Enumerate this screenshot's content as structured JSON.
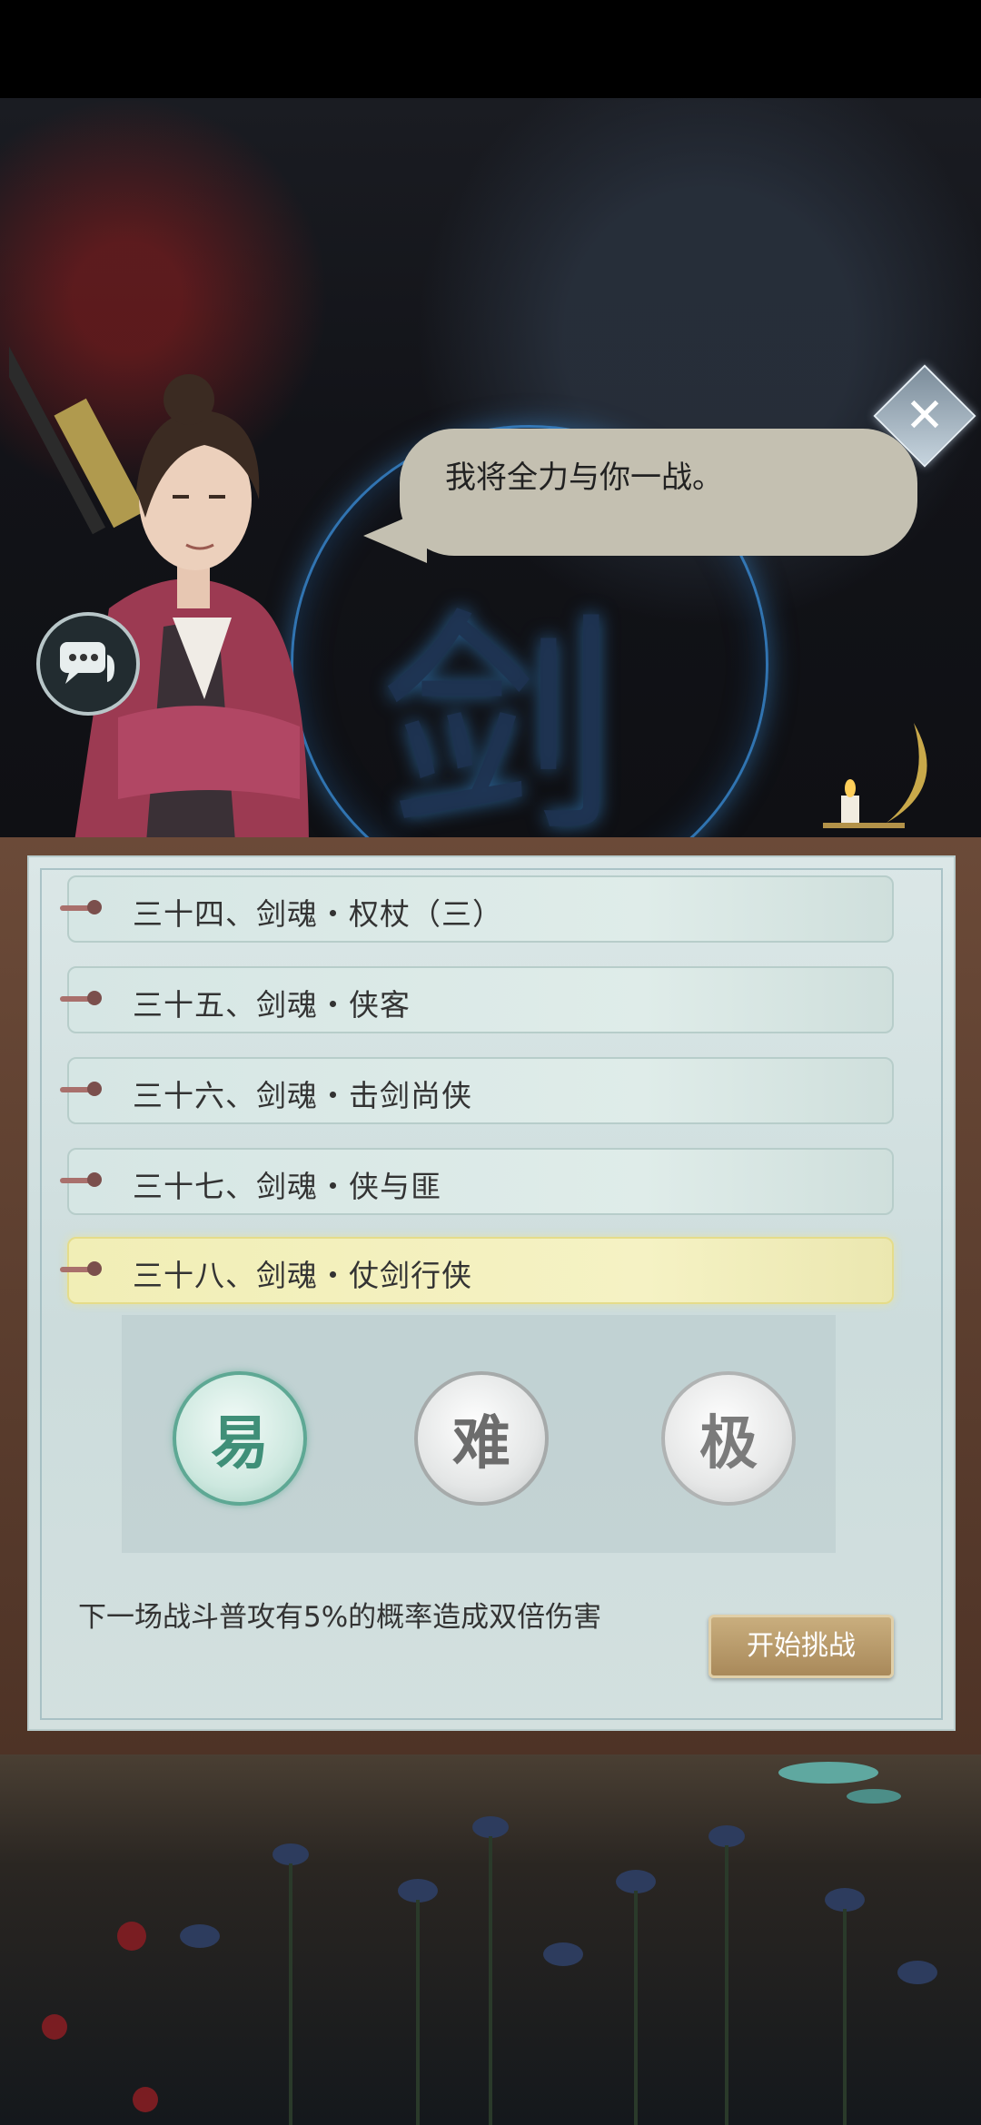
{
  "dialog": {
    "speech": "我将全力与你一战。",
    "background_glyph": "剑"
  },
  "chapters": [
    {
      "label": "三十四、剑魂・权杖（三）",
      "active": false
    },
    {
      "label": "三十五、剑魂・侠客",
      "active": false
    },
    {
      "label": "三十六、剑魂・击剑尚侠",
      "active": false
    },
    {
      "label": "三十七、剑魂・侠与匪",
      "active": false
    },
    {
      "label": "三十八、剑魂・仗剑行侠",
      "active": true
    }
  ],
  "difficulty": {
    "easy": "易",
    "hard": "难",
    "extreme": "极",
    "selected": "easy"
  },
  "description": "下一场战斗普攻有5%的概率造成双倍伤害",
  "start_button": "开始挑战",
  "icons": {
    "close": "close-icon",
    "chat": "chat-bubble-icon",
    "candle": "candle-icon"
  },
  "colors": {
    "panel_bg": "#dbe7e7",
    "active_chapter": "#f5f2c4",
    "start_button": "#b8996a",
    "glow_ring": "#3c96e6"
  }
}
